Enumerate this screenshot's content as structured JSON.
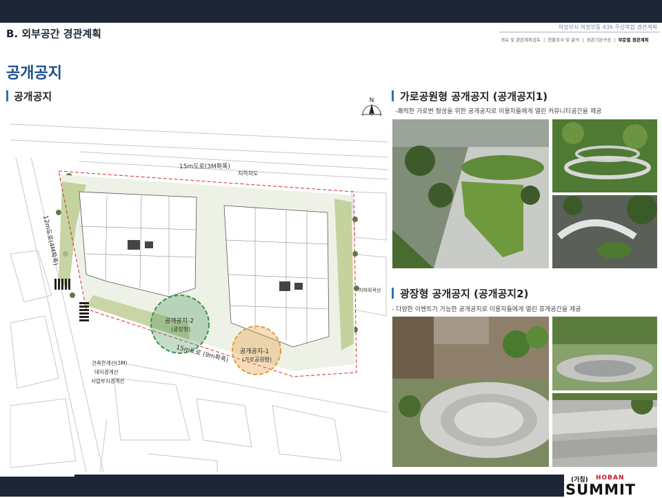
{
  "header": {
    "section_title": "B. 외부공간 경관계획",
    "project_title": "의정부시 의정부동 436 주상복합 경관계획",
    "nav": [
      "개요 및 관련계획검토",
      "현황조사 및 분석",
      "경관기본구상",
      "부문별 경관계획"
    ],
    "nav_separator": "|",
    "active_nav_index": 3
  },
  "page_title": "공개공지",
  "left": {
    "heading": "공개공지",
    "compass_label": "N",
    "plan_labels": {
      "road_top": "15m도로(3M확폭)",
      "underpass": "지하차도",
      "road_left": "12m도로(4M확폭)",
      "road_bottom": "15m도로 (9m확폭)",
      "basement_line": "지하외곽선",
      "public_space_2": "공개공지-2",
      "public_space_2_sub": "(광장형)",
      "public_space_1": "공개공지-1",
      "public_space_1_sub": "(가로공원형)",
      "note_lines": [
        "건축한계선(3M)",
        "대지경계선",
        "사업부지경계선"
      ]
    }
  },
  "right": {
    "section1": {
      "heading": "가로공원형 공개공지 (공개공지1)",
      "description": "-쾌적한 가로변 형성을 위한 공개공지로 이용자들에게 열린 커뮤니티공간을 제공"
    },
    "section2": {
      "heading": "광장형 공개공지 (공개공지2)",
      "description": "- 다양한 이벤트가 가능한 공개공지로 이용자들에게 열린 휴게공간을 제공"
    }
  },
  "footer": {
    "brand_prefix": "(가칭)",
    "brand_small": "HOBAN",
    "brand": "SUMMIT"
  },
  "colors": {
    "dark_bar": "#1c2636",
    "title_blue": "#1e4f8a",
    "accent_bar": "#2d6fb5",
    "zone_green": "#3c8f50",
    "zone_orange": "#e49a3a",
    "boundary_red": "#d22a2a",
    "brand_red": "#c8102e"
  }
}
